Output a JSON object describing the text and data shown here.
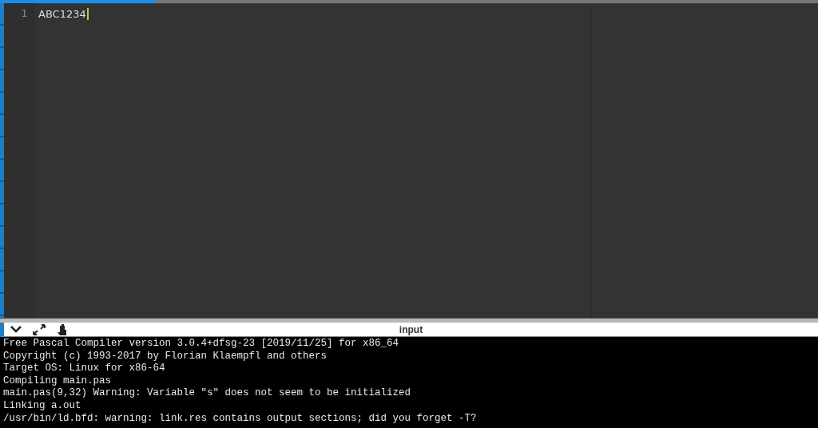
{
  "editor": {
    "lines": [
      {
        "number": "1",
        "text": "ABC1234"
      }
    ]
  },
  "console": {
    "title": "input",
    "lines": [
      "Free Pascal Compiler version 3.0.4+dfsg-23 [2019/11/25] for x86_64",
      "Copyright (c) 1993-2017 by Florian Klaempfl and others",
      "Target OS: Linux for x86-64",
      "Compiling main.pas",
      "main.pas(9,32) Warning: Variable \"s\" does not seem to be initialized",
      "Linking a.out",
      "/usr/bin/ld.bfd: warning: link.res contains output sections; did you forget -T?"
    ]
  }
}
